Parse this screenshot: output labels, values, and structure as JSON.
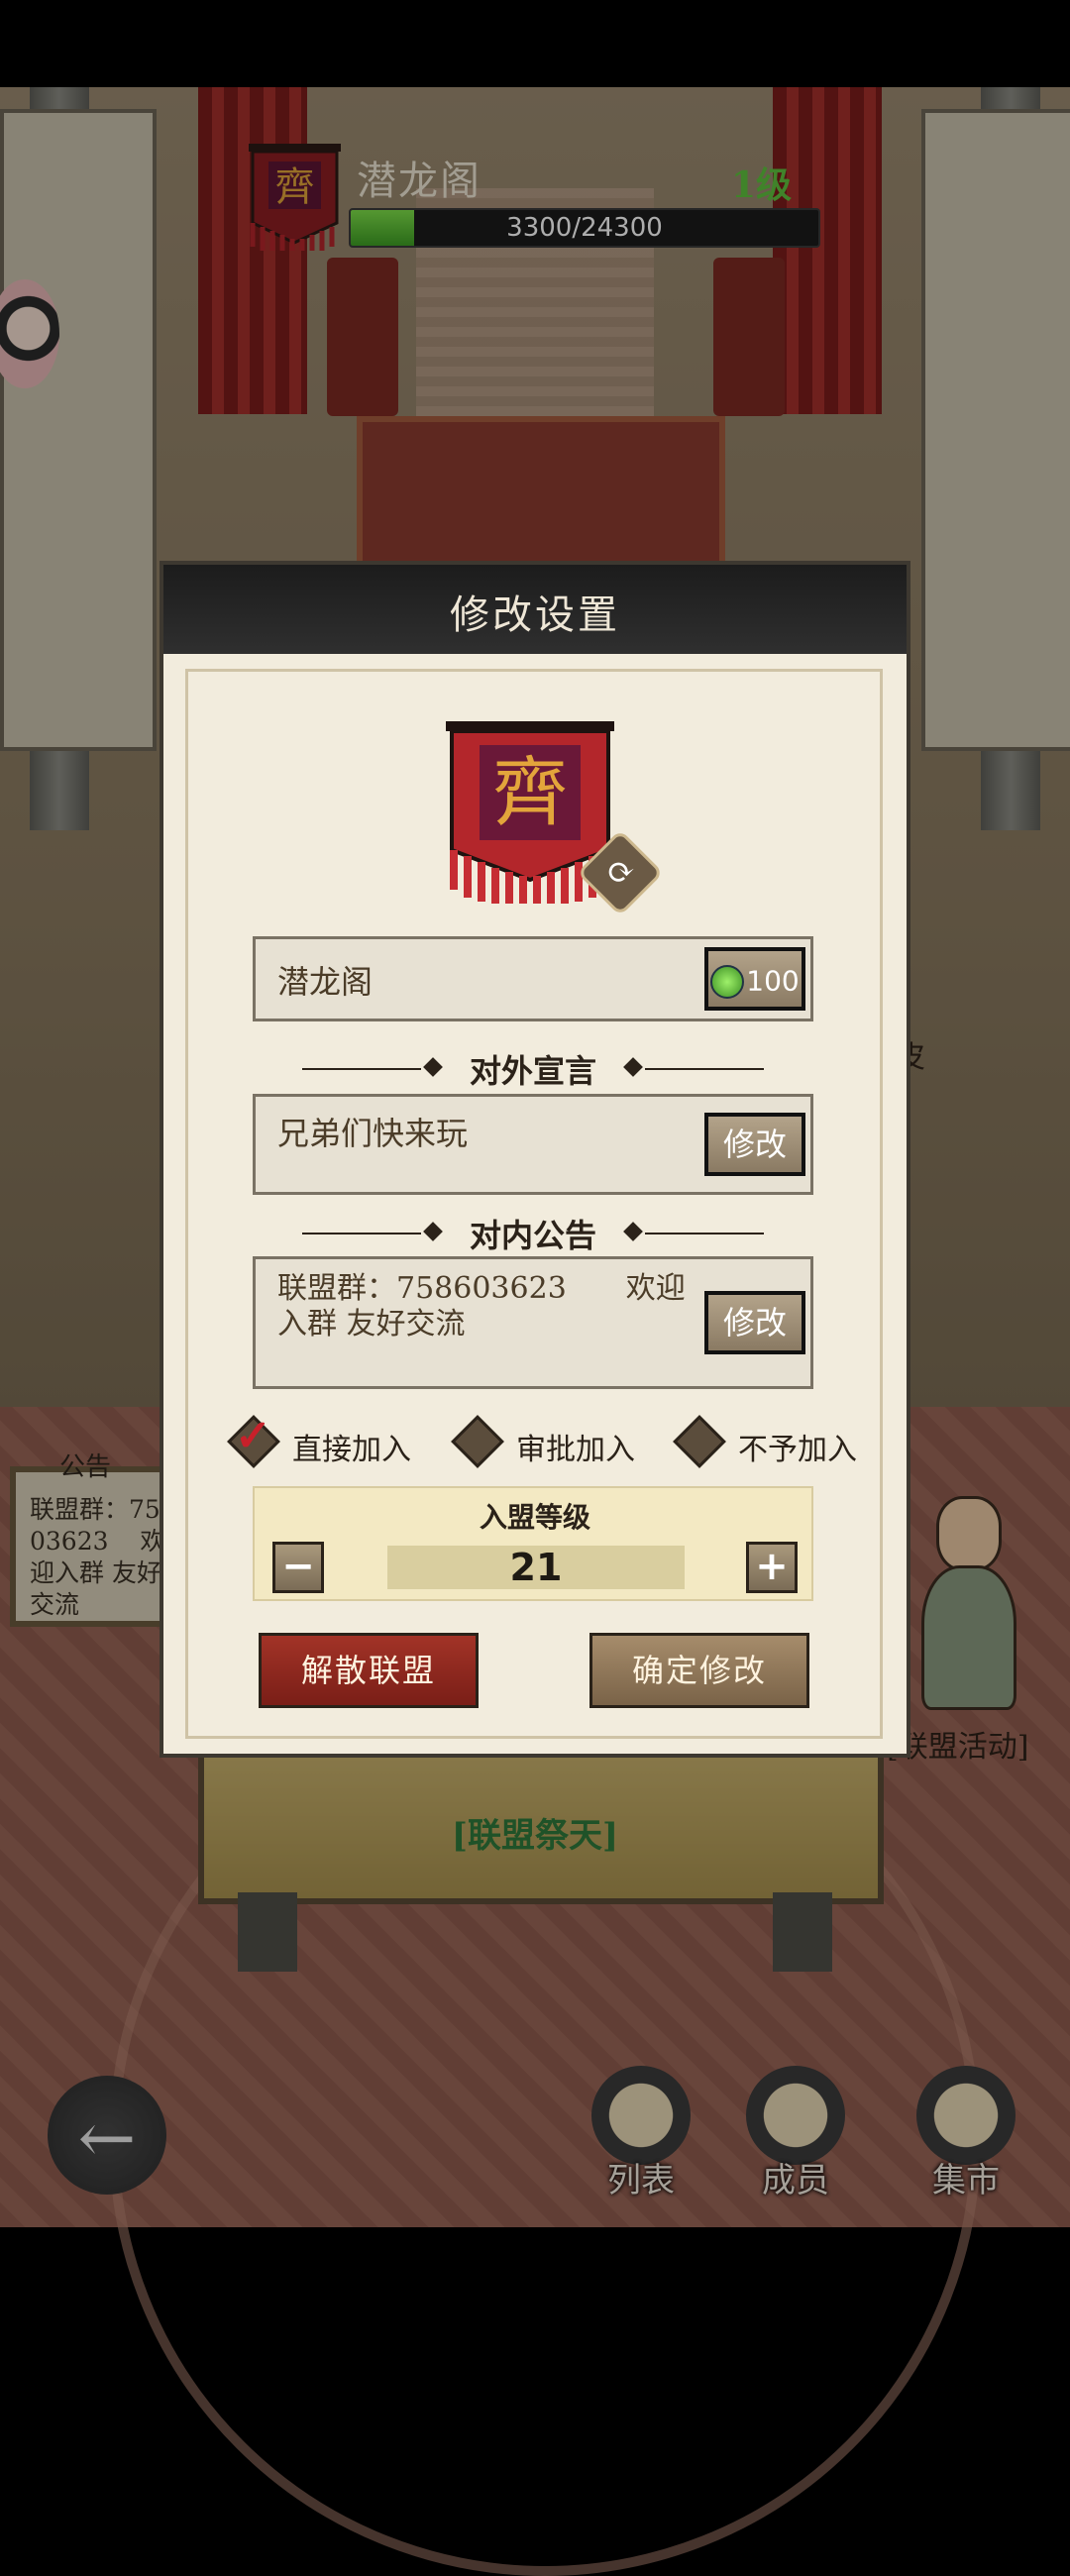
{
  "header": {
    "alliance_name": "潜龙阁",
    "level": "1级",
    "exp_text": "3300/24300",
    "exp_progress": 0.136,
    "flag_glyph": "齊"
  },
  "background": {
    "notice_title": "公告",
    "notice_text": "联盟群：75\n03623    欢\n迎入群 友好\n交流",
    "altar_label": "[联盟祭天]",
    "npc_label": "[联盟活动]",
    "right_partial_text": "皮"
  },
  "dialog": {
    "title": "修改设置",
    "emblem_glyph": "齊",
    "name_value": "潜龙阁",
    "rename_cost": "100",
    "external_header": "对外宣言",
    "external_text": "兄弟们快来玩",
    "external_modify": "修改",
    "internal_header": "对内公告",
    "internal_text": "联盟群：758603623　　欢迎入群 友好交流",
    "internal_modify": "修改",
    "join_options": [
      {
        "label": "直接加入",
        "selected": true
      },
      {
        "label": "审批加入",
        "selected": false
      },
      {
        "label": "不予加入",
        "selected": false
      }
    ],
    "level_label": "入盟等级",
    "level_value": "21",
    "minus": "−",
    "plus": "+",
    "disband_button": "解散联盟",
    "confirm_button": "确定修改"
  },
  "nav": {
    "back": "←",
    "list": "列表",
    "members": "成员",
    "market": "集市"
  },
  "colors": {
    "accent_red": "#a23327",
    "level_green": "#5fc23f",
    "dialog_bg": "#f2ecdd"
  }
}
